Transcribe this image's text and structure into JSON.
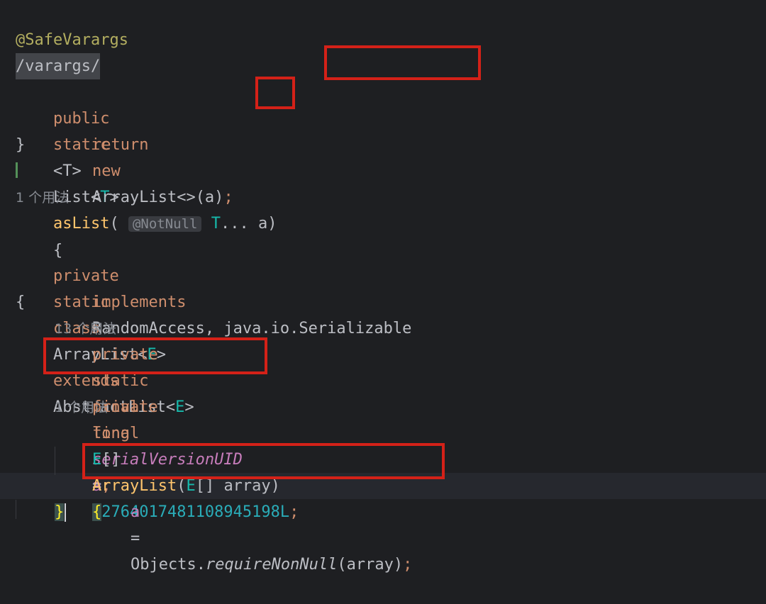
{
  "editor": {
    "lines": {
      "l1_annotation": "@SafeVarargs",
      "l2_comment": "/varargs/",
      "l3_public": "public",
      "l3_static": "static",
      "l3_generic": "<T>",
      "l3_list": "List<",
      "l3_t": "T",
      "l3_gt": ">",
      "l3_method": "asList",
      "l3_paren_open": "(",
      "l3_inlay": "@NotNull",
      "l3_param_type": "T",
      "l3_dots": "...",
      "l3_param": "a",
      "l3_paren_close": ")",
      "l3_brace": "{",
      "l4_return": "return",
      "l4_new": "new",
      "l4_type": "ArrayList<",
      "l4_gt": ">",
      "l4_args": "(a)",
      "l4_semi": ";",
      "l5_brace": "}",
      "usage_1": "1 个用法",
      "l8_private": "private",
      "l8_static": "static",
      "l8_class": "class",
      "l8_name": "ArrayList<",
      "l8_e": "E",
      "l8_gt": ">",
      "l8_extends": "extends",
      "l8_abstract": "AbstractList<",
      "l8_e2": "E",
      "l8_gt2": ">",
      "l9_implements": "implements",
      "l9_rest": "RandomAccess, java.io.Serializable",
      "l10_brace": "{",
      "l11_private": "private",
      "l11_static": "static",
      "l11_final": "final",
      "l11_long": "long",
      "l11_field": "serialVersionUID",
      "l11_eq": "=",
      "l11_value": "-2764017481108945198L",
      "l11_semi": ";",
      "usage_13": "13 个用法",
      "l13_private": "private",
      "l13_final": "final",
      "l13_type": "E",
      "l13_brackets": "[]",
      "l13_field": "a",
      "l13_semi": ";",
      "usage_1b": "1 个用法",
      "l15_ctor": "ArrayList",
      "l15_paren": "(",
      "l15_type": "E",
      "l15_rest": "[] array)",
      "l15_brace": "{",
      "l16_field": "a",
      "l16_eq": "=",
      "l16_objects": "Objects.",
      "l16_method": "requireNonNull",
      "l16_args": "(array)",
      "l16_semi": ";",
      "l17_brace": "}"
    }
  }
}
